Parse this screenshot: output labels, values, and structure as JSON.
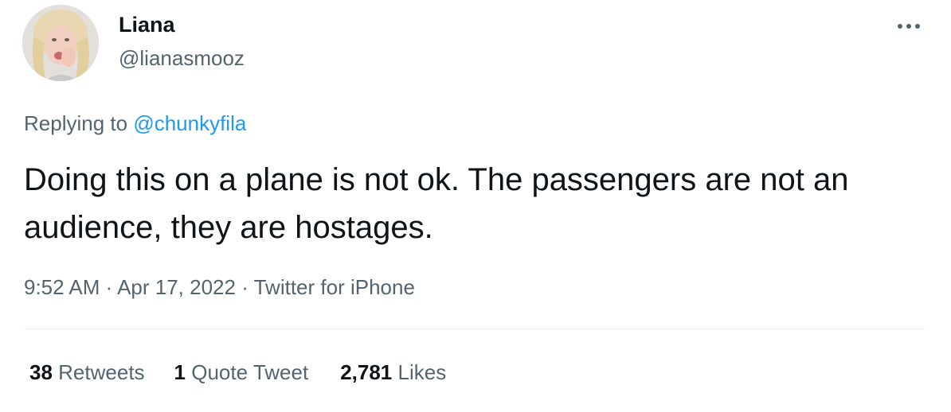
{
  "author": {
    "display_name": "Liana",
    "handle": "@lianasmooz",
    "avatar_icon": "profile-photo"
  },
  "menu": {
    "more_icon": "ellipsis-horizontal-icon"
  },
  "reply": {
    "prefix": "Replying to ",
    "mention": "@chunkyfila"
  },
  "tweet": {
    "text": "Doing this on a plane is not ok. The passengers are not an audience, they are hostages."
  },
  "meta": {
    "time": "9:52 AM",
    "separator": " · ",
    "date": "Apr 17, 2022",
    "source": "Twitter for iPhone"
  },
  "stats": {
    "retweets": {
      "count": "38",
      "label": "Retweets"
    },
    "quotes": {
      "count": "1",
      "label": "Quote Tweet"
    },
    "likes": {
      "count": "2,781",
      "label": "Likes"
    }
  },
  "colors": {
    "text": "#0f1419",
    "secondary": "#536471",
    "link": "#1d9bf0",
    "divider": "#eff3f4"
  }
}
